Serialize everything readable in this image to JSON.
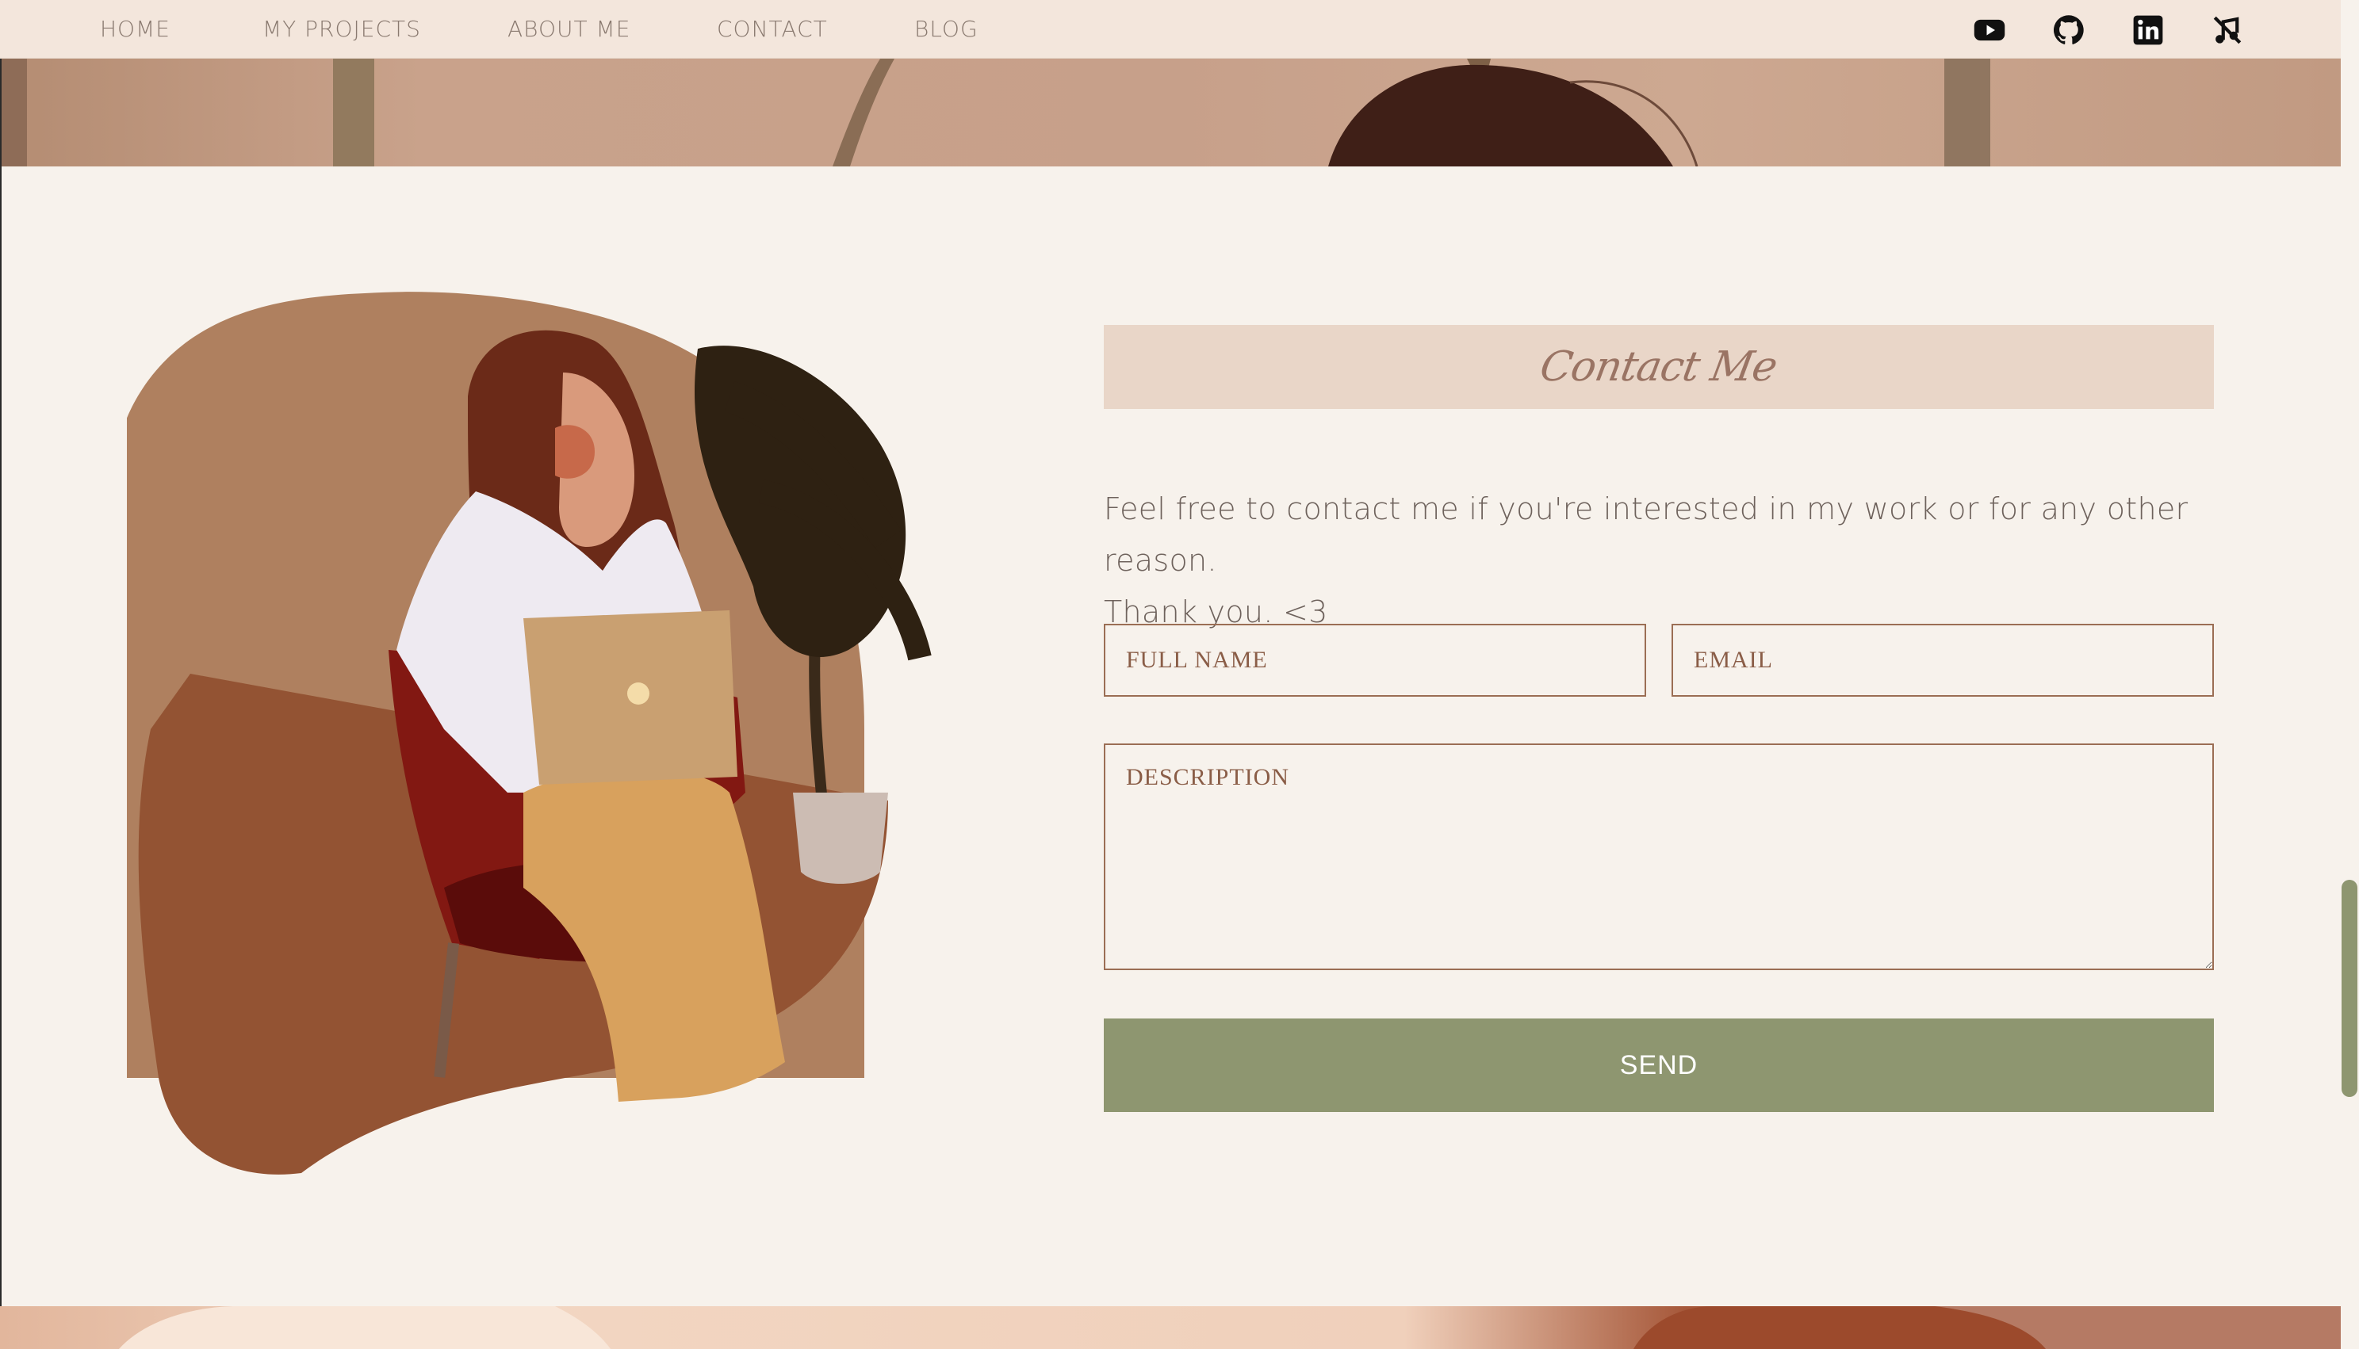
{
  "nav": {
    "items": [
      {
        "label": "HOME"
      },
      {
        "label": "MY PROJECTS"
      },
      {
        "label": "ABOUT ME"
      },
      {
        "label": "CONTACT"
      },
      {
        "label": "BLOG"
      }
    ],
    "social": [
      "youtube-icon",
      "github-icon",
      "linkedin-icon",
      "music-off-icon"
    ]
  },
  "contact": {
    "title": "Contact Me",
    "intro_line1": "Feel free to contact me if you're interested in my work or for any other reason.",
    "intro_line2": "Thank you. <3",
    "full_name_placeholder": "FULL NAME",
    "email_placeholder": "EMAIL",
    "description_placeholder": "DESCRIPTION",
    "send_label": "SEND"
  },
  "colors": {
    "background": "#f7f2ec",
    "nav_background": "#f3e6dc",
    "accent_button": "#8e9670",
    "field_border": "#9b6e54",
    "header_band": "#e9d6c8"
  }
}
